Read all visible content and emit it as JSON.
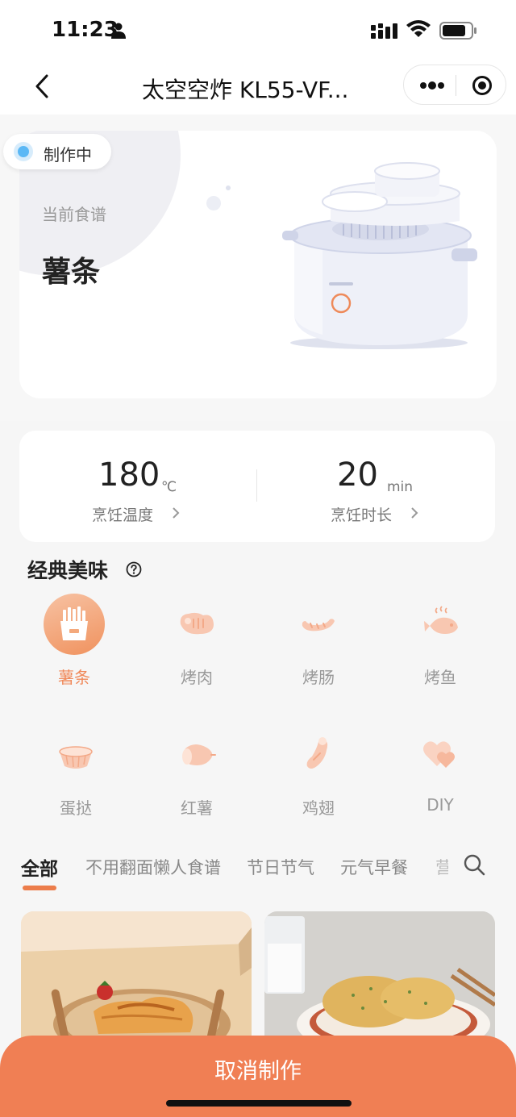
{
  "status_bar": {
    "time": "11:23"
  },
  "nav": {
    "title": "太空空炸 KL55-VF..."
  },
  "hero": {
    "badge": "制作中",
    "recipe_label": "当前食谱",
    "recipe_name": "薯条"
  },
  "params": {
    "temperature": {
      "value": "180",
      "unit": "℃",
      "label": "烹饪温度"
    },
    "duration": {
      "value": "20",
      "unit": "min",
      "label": "烹饪时长"
    }
  },
  "section": {
    "title": "经典美味"
  },
  "modes": [
    {
      "label": "薯条",
      "icon": "fries-icon",
      "active": true
    },
    {
      "label": "烤肉",
      "icon": "meat-icon",
      "active": false
    },
    {
      "label": "烤肠",
      "icon": "sausage-icon",
      "active": false
    },
    {
      "label": "烤鱼",
      "icon": "fish-icon",
      "active": false
    },
    {
      "label": "蛋挞",
      "icon": "egg-tart-icon",
      "active": false
    },
    {
      "label": "红薯",
      "icon": "sweet-potato-icon",
      "active": false
    },
    {
      "label": "鸡翅",
      "icon": "chicken-wing-icon",
      "active": false
    },
    {
      "label": "DIY",
      "icon": "hearts-icon",
      "active": false
    }
  ],
  "tabs": [
    {
      "label": "全部",
      "active": true
    },
    {
      "label": "不用翻面懒人食谱",
      "active": false
    },
    {
      "label": "节日节气",
      "active": false
    },
    {
      "label": "元气早餐",
      "active": false
    },
    {
      "label": "营",
      "active": false
    }
  ],
  "bottom": {
    "cancel_label": "取消制作"
  },
  "colors": {
    "accent": "#F07F54",
    "active_label": "#F0895A",
    "status_dot": "#5BB8F5"
  }
}
